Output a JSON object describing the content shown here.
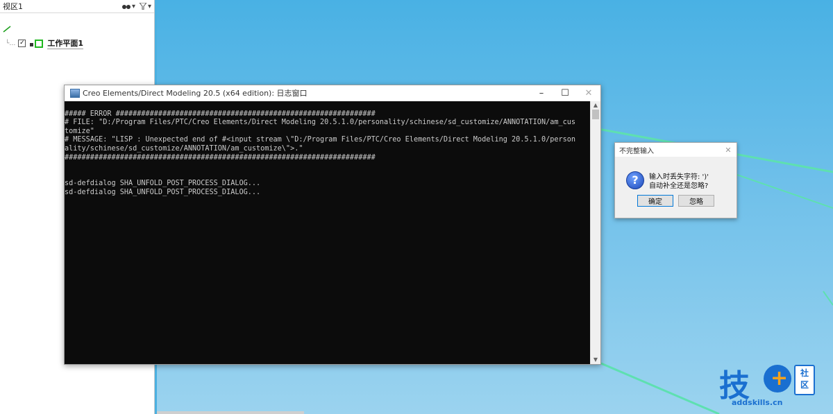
{
  "tree": {
    "header_title": "视区1",
    "binoculars_icon": "binoculars-icon",
    "filter_icon": "filter-icon",
    "item_label": "工作平面1",
    "item_checked": true
  },
  "console": {
    "title": "Creo Elements/Direct Modeling 20.5 (x64 edition): 日志窗口",
    "minimize": "–",
    "maximize": "☐",
    "close": "✕",
    "lines": [
      "",
      "##### ERROR #############################################################",
      "# FILE: \"D:/Program Files/PTC/Creo Elements/Direct Modeling 20.5.1.0/personality/schinese/sd_customize/ANNOTATION/am_cus",
      "tomize\"",
      "# MESSAGE: \"LISP : Unexpected end of #<input stream \\\"D:/Program Files/PTC/Creo Elements/Direct Modeling 20.5.1.0/person",
      "ality/schinese/sd_customize/ANNOTATION/am_customize\\\">.\"",
      "#########################################################################",
      "",
      "",
      "sd-defdialog SHA_UNFOLD_POST_PROCESS_DIALOG...",
      "sd-defdialog SHA_UNFOLD_POST_PROCESS_DIALOG..."
    ]
  },
  "dialog": {
    "title": "不完整输入",
    "close": "✕",
    "line1": "输入时丢失字符: ')'",
    "line2": "自动补全还是忽略?",
    "ok_label": "确定",
    "ignore_label": "忽略",
    "icon": "question-icon"
  },
  "logo": {
    "char1": "技",
    "plus": "+",
    "char2": "社区",
    "url": "addskills.cn"
  },
  "colors": {
    "viewport": "#4bb0e0",
    "edge": "#5ee0b0",
    "console_bg": "#0c0c0c",
    "logo_blue": "#1a6fd0",
    "logo_orange": "#f7a21b"
  }
}
